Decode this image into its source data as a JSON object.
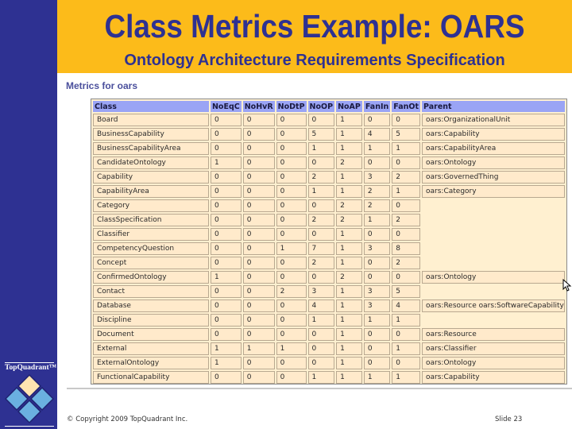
{
  "slide": {
    "title": "Class Metrics Example: OARS",
    "subtitle": "Ontology Architecture Requirements Specification",
    "section_title": "Metrics for oars",
    "footer_copyright": "© Copyright 2009 TopQuadrant Inc.",
    "footer_slide": "Slide 23",
    "logo_text": "TopQuadrant™"
  },
  "colors": {
    "brand_blue": "#2e3192",
    "header_orange": "#fcbb1a",
    "table_header": "#9aa4f5",
    "table_cell": "#ffeacb"
  },
  "table": {
    "columns": [
      "Class",
      "NoEqC",
      "NoHvR",
      "NoDtP",
      "NoOP",
      "NoAP",
      "FanIn",
      "FanOt",
      "Parent"
    ],
    "rows": [
      [
        "Board",
        "0",
        "0",
        "0",
        "0",
        "1",
        "0",
        "0",
        "oars:OrganizationalUnit"
      ],
      [
        "BusinessCapability",
        "0",
        "0",
        "0",
        "5",
        "1",
        "4",
        "5",
        "oars:Capability"
      ],
      [
        "BusinessCapabilityArea",
        "0",
        "0",
        "0",
        "1",
        "1",
        "1",
        "1",
        "oars:CapabilityArea"
      ],
      [
        "CandidateOntology",
        "1",
        "0",
        "0",
        "0",
        "2",
        "0",
        "0",
        "oars:Ontology"
      ],
      [
        "Capability",
        "0",
        "0",
        "0",
        "2",
        "1",
        "3",
        "2",
        "oars:GovernedThing"
      ],
      [
        "CapabilityArea",
        "0",
        "0",
        "0",
        "1",
        "1",
        "2",
        "1",
        "oars:Category"
      ],
      [
        "Category",
        "0",
        "0",
        "0",
        "0",
        "2",
        "2",
        "0",
        ""
      ],
      [
        "ClassSpecification",
        "0",
        "0",
        "0",
        "2",
        "2",
        "1",
        "2",
        ""
      ],
      [
        "Classifier",
        "0",
        "0",
        "0",
        "0",
        "1",
        "0",
        "0",
        ""
      ],
      [
        "CompetencyQuestion",
        "0",
        "0",
        "1",
        "7",
        "1",
        "3",
        "8",
        ""
      ],
      [
        "Concept",
        "0",
        "0",
        "0",
        "2",
        "1",
        "0",
        "2",
        ""
      ],
      [
        "ConfirmedOntology",
        "1",
        "0",
        "0",
        "0",
        "2",
        "0",
        "0",
        "oars:Ontology"
      ],
      [
        "Contact",
        "0",
        "0",
        "2",
        "3",
        "1",
        "3",
        "5",
        ""
      ],
      [
        "Database",
        "0",
        "0",
        "0",
        "4",
        "1",
        "3",
        "4",
        "oars:Resource oars:SoftwareCapability"
      ],
      [
        "Discipline",
        "0",
        "0",
        "0",
        "1",
        "1",
        "1",
        "1",
        ""
      ],
      [
        "Document",
        "0",
        "0",
        "0",
        "0",
        "1",
        "0",
        "0",
        "oars:Resource"
      ],
      [
        "External",
        "1",
        "1",
        "1",
        "0",
        "1",
        "0",
        "1",
        "oars:Classifier"
      ],
      [
        "ExternalOntology",
        "1",
        "0",
        "0",
        "0",
        "1",
        "0",
        "0",
        "oars:Ontology"
      ],
      [
        "FunctionalCapability",
        "0",
        "0",
        "0",
        "1",
        "1",
        "1",
        "1",
        "oars:Capability"
      ]
    ]
  }
}
